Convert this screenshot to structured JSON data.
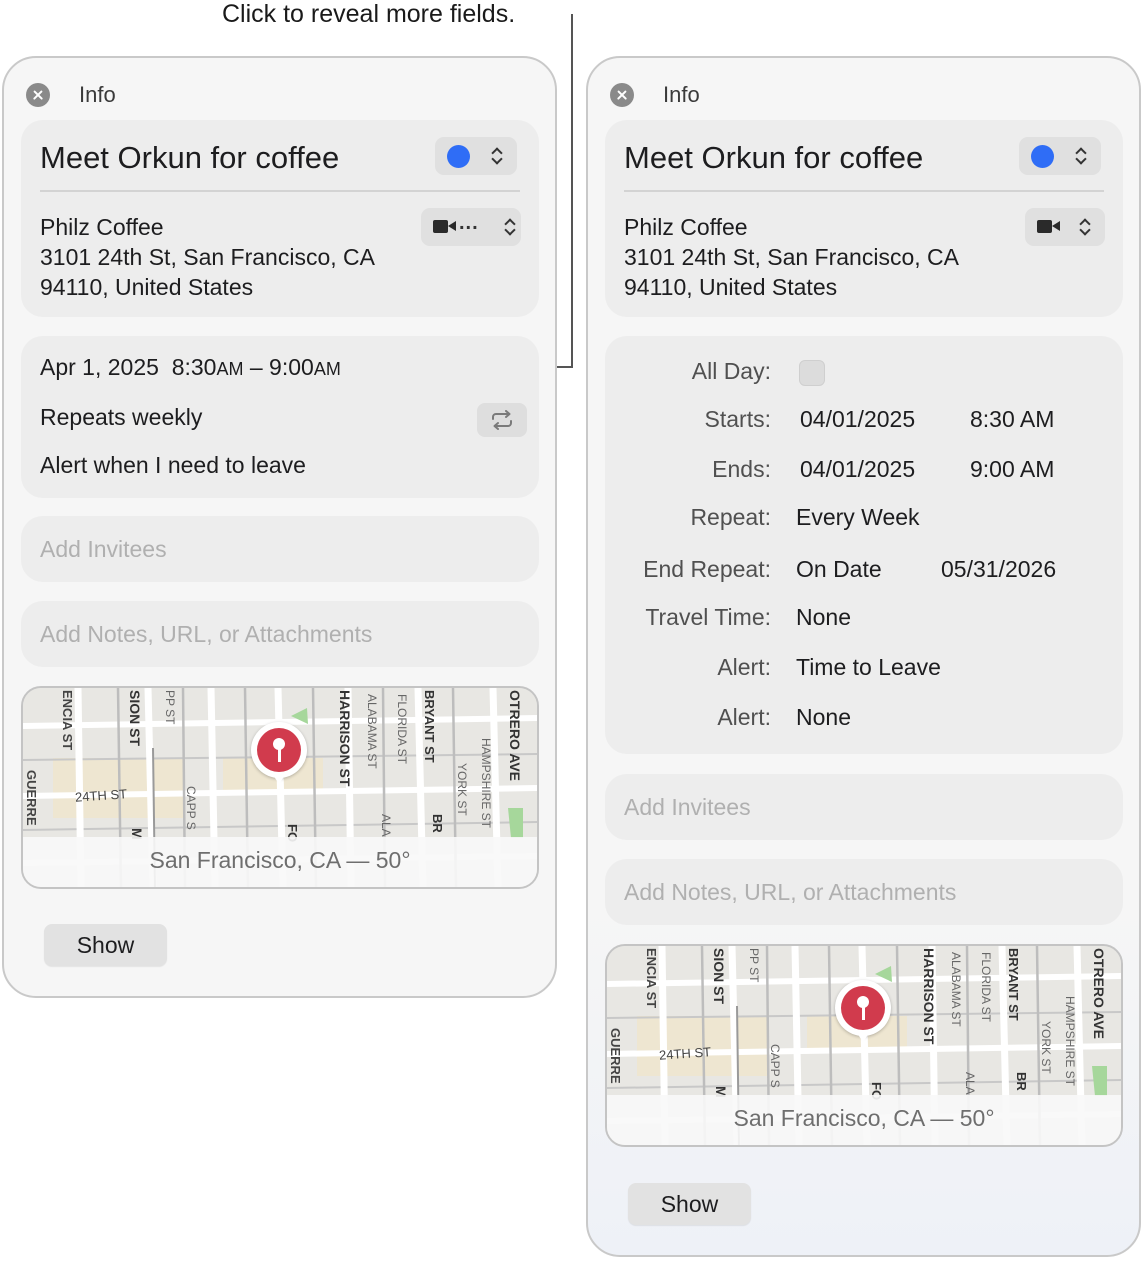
{
  "callout": "Click to reveal more fields.",
  "panel": {
    "title": "Info",
    "event_title": "Meet Orkun for coffee",
    "calendar_color": "#2f6df6",
    "location": [
      "Philz Coffee",
      "3101 24th St, San Francisco, CA",
      "94110, United States"
    ],
    "invitees_placeholder": "Add Invitees",
    "notes_placeholder": "Add Notes, URL, or Attachments",
    "map_caption": "San Francisco, CA — 50°",
    "show_label": "Show",
    "video_ellipsis": "..."
  },
  "collapsed": {
    "date": "Apr 1, 2025",
    "start_time": "8:30",
    "start_ampm": "AM",
    "dash": " – ",
    "end_time": "9:00",
    "end_ampm": "AM",
    "repeat": "Repeats weekly",
    "alert": "Alert when I need to leave"
  },
  "expanded": {
    "all_day_label": "All Day:",
    "starts_label": "Starts:",
    "starts_date": "04/01/2025",
    "starts_time": "8:30 AM",
    "ends_label": "Ends:",
    "ends_date": "04/01/2025",
    "ends_time": "9:00 AM",
    "repeat_label": "Repeat:",
    "repeat_value": "Every Week",
    "end_repeat_label": "End Repeat:",
    "end_repeat_mode": "On Date",
    "end_repeat_date": "05/31/2026",
    "travel_label": "Travel Time:",
    "travel_value": "None",
    "alert1_label": "Alert:",
    "alert1_value": "Time to Leave",
    "alert2_label": "Alert:",
    "alert2_value": "None"
  },
  "map_labels": {
    "valencia": "ENCIA ST",
    "mission": "SION ST",
    "capp_top": "PP ST",
    "street_24th": "24TH ST",
    "capp": "CAPP S",
    "guerrero": "GUERRE",
    "harrison": "HARRISON ST",
    "alabama": "ALABAMA ST",
    "florida": "FLORIDA ST",
    "bryant": "BRYANT ST",
    "york": "YORK ST",
    "hampshire": "HAMPSHIRE ST",
    "potrero": "OTRERO AVE",
    "folsom": "FO",
    "m_letter": "M",
    "ala": "ALA",
    "br": "BR"
  }
}
